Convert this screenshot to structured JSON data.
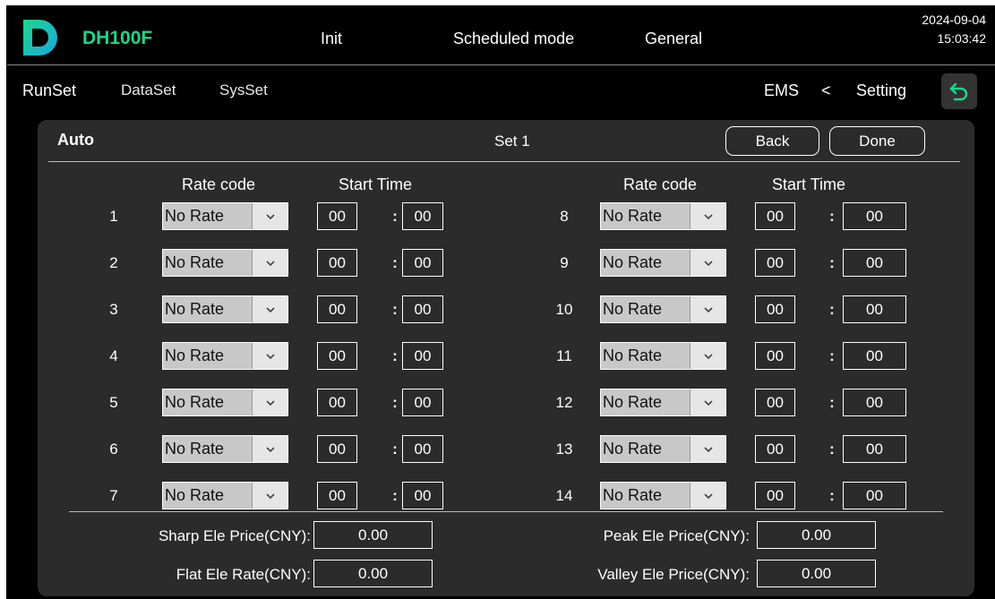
{
  "header": {
    "brand": "DH100F",
    "status_init": "Init",
    "mode": "Scheduled mode",
    "profile": "General",
    "date": "2024-09-04",
    "time": "15:03:42"
  },
  "nav": {
    "tabs": [
      "RunSet",
      "DataSet",
      "SysSet"
    ],
    "breadcrumb_ems": "EMS",
    "breadcrumb_sep": "<",
    "breadcrumb_setting": "Setting"
  },
  "panel": {
    "title": "Auto",
    "set_label": "Set 1",
    "back_label": "Back",
    "done_label": "Done",
    "col_rate_code": "Rate code",
    "col_start_time": "Start Time"
  },
  "rows": [
    {
      "num": "1",
      "rate": "No Rate",
      "hh": "00",
      "mm": "00"
    },
    {
      "num": "2",
      "rate": "No Rate",
      "hh": "00",
      "mm": "00"
    },
    {
      "num": "3",
      "rate": "No Rate",
      "hh": "00",
      "mm": "00"
    },
    {
      "num": "4",
      "rate": "No Rate",
      "hh": "00",
      "mm": "00"
    },
    {
      "num": "5",
      "rate": "No Rate",
      "hh": "00",
      "mm": "00"
    },
    {
      "num": "6",
      "rate": "No Rate",
      "hh": "00",
      "mm": "00"
    },
    {
      "num": "7",
      "rate": "No Rate",
      "hh": "00",
      "mm": "00"
    },
    {
      "num": "8",
      "rate": "No Rate",
      "hh": "00",
      "mm": "00"
    },
    {
      "num": "9",
      "rate": "No Rate",
      "hh": "00",
      "mm": "00"
    },
    {
      "num": "10",
      "rate": "No Rate",
      "hh": "00",
      "mm": "00"
    },
    {
      "num": "11",
      "rate": "No Rate",
      "hh": "00",
      "mm": "00"
    },
    {
      "num": "12",
      "rate": "No Rate",
      "hh": "00",
      "mm": "00"
    },
    {
      "num": "13",
      "rate": "No Rate",
      "hh": "00",
      "mm": "00"
    },
    {
      "num": "14",
      "rate": "No Rate",
      "hh": "00",
      "mm": "00"
    }
  ],
  "time_separator": ":",
  "prices": {
    "sharp_label": "Sharp Ele Price(CNY):",
    "sharp_value": "0.00",
    "peak_label": "Peak Ele Price(CNY):",
    "peak_value": "0.00",
    "flat_label": "Flat Ele Rate(CNY):",
    "flat_value": "0.00",
    "valley_label": "Valley Ele Price(CNY):",
    "valley_value": "0.00"
  },
  "colors": {
    "accent_green": "#1fd58a",
    "logo_gradient": [
      "#1fd58a",
      "#1aa8e0"
    ]
  },
  "icons": {
    "logo": "brand-d-logo",
    "back": "return-arrow-icon",
    "dropdown": "chevron-down-icon"
  }
}
